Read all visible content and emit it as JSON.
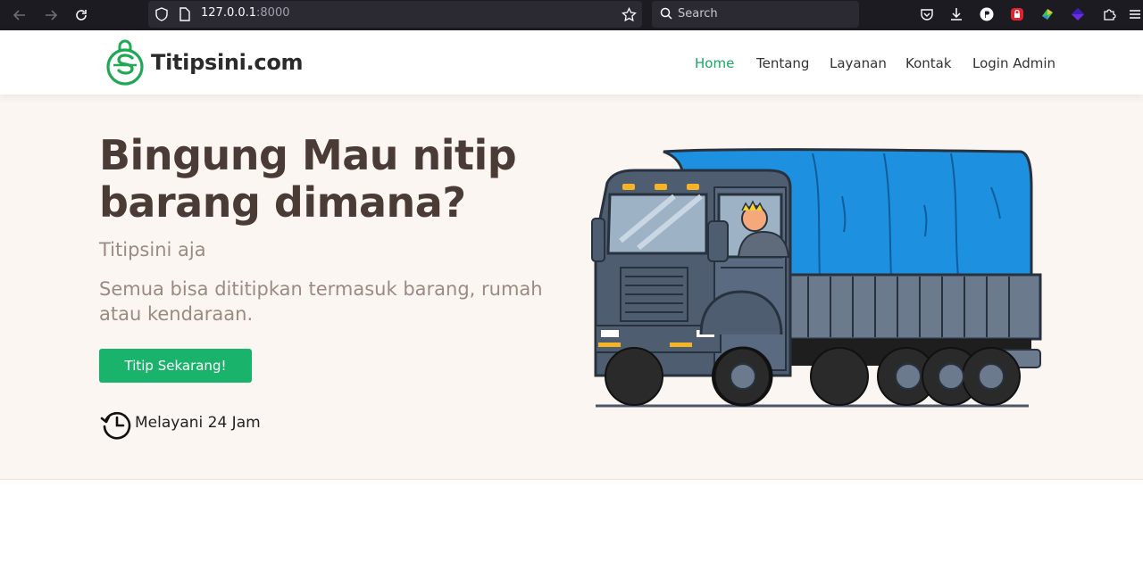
{
  "browser": {
    "url_host": "127.0.0.1",
    "url_port": ":8000",
    "search_placeholder": "Search"
  },
  "header": {
    "brand": "Titipsini.com",
    "menu": [
      {
        "label": "Home",
        "active": true
      },
      {
        "label": "Tentang",
        "active": false
      },
      {
        "label": "Layanan",
        "active": false
      },
      {
        "label": "Kontak",
        "active": false
      },
      {
        "label": "Login Admin",
        "active": false
      }
    ]
  },
  "hero": {
    "title": "Bingung Mau nitip barang dimana?",
    "subtitle": "Titipsini aja",
    "description": "Semua bisa dititipkan termasuk barang, rumah atau kendaraan.",
    "cta_label": "Titip Sekarang!",
    "service_hours": "Melayani 24 Jam"
  },
  "colors": {
    "accent": "#19b36b",
    "hero_bg": "#fcf6f2",
    "heading": "#4a3b36",
    "muted": "#9b8a82"
  }
}
